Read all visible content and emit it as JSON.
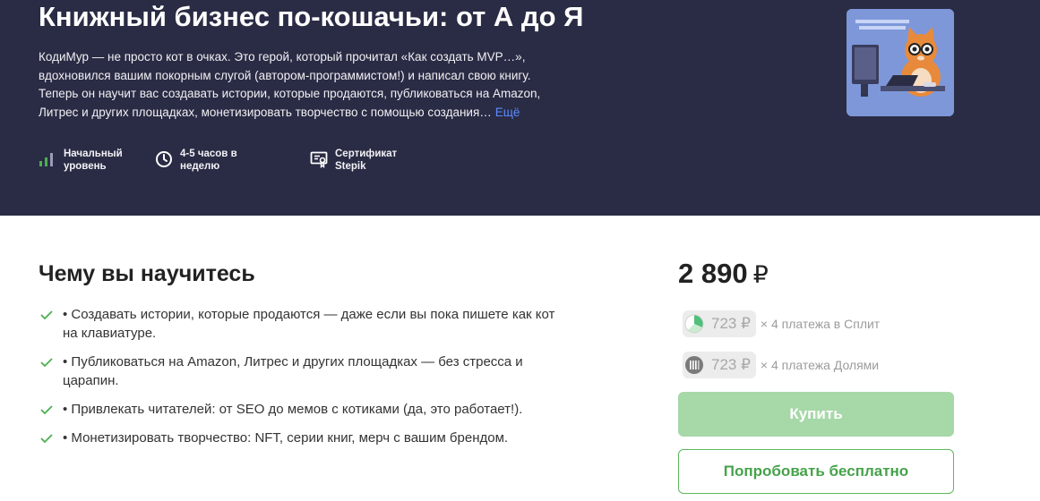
{
  "course": {
    "title": "Книжный бизнес по-кошачьи: от А до Я",
    "description_lines": [
      "КодиМур — не просто кот в очках. Это герой, который прочитал «Как создать MVP…»,",
      "вдохновился вашим покорным слугой (автором-программистом!) и написал свою книгу.",
      "Теперь он научит вас создавать истории, которые продаются, публиковаться на Amazon,",
      "Литрес и других площадках, монетизировать творчество с помощью создания…"
    ],
    "more_label": "Ещё",
    "cover_icon": "cat-with-laptop-cover"
  },
  "features": [
    {
      "icon": "level-bars-icon",
      "lines": [
        "Начальный",
        "уровень"
      ]
    },
    {
      "icon": "clock-icon",
      "lines": [
        "4-5 часов в",
        "неделю"
      ]
    },
    {
      "icon": "certificate-icon",
      "lines": [
        "Сертификат",
        "Stepik"
      ]
    }
  ],
  "learn": {
    "title": "Чему вы научитесь",
    "items": [
      {
        "lines": [
          "• Создавать истории, которые продаются — даже если вы пока пишете как кот",
          "на клавиатуре."
        ]
      },
      {
        "lines": [
          "• Публиковаться на Amazon, Литрес и других площадках — без стресса и",
          "царапин."
        ]
      },
      {
        "lines": [
          "• Привлекать читателей: от SEO до мемов с котиками (да, это работает!)."
        ]
      },
      {
        "lines": [
          "• Монетизировать творчество: NFT, серии книг, мерч с вашим брендом."
        ]
      }
    ]
  },
  "pricing": {
    "price": "2 890",
    "currency": "₽",
    "split": {
      "amount": "723 ₽",
      "mult": "× 4 платежа в Сплит"
    },
    "dolyami": {
      "amount": "723 ₽",
      "mult": "× 4 платежа Долями"
    },
    "buy_label": "Купить",
    "try_label": "Попробовать бесплатно"
  },
  "colors": {
    "hero_bg": "#2a2b44",
    "link": "#5b8cff",
    "accent_green": "#46a24a",
    "buy_bg": "#a6d8a8"
  }
}
